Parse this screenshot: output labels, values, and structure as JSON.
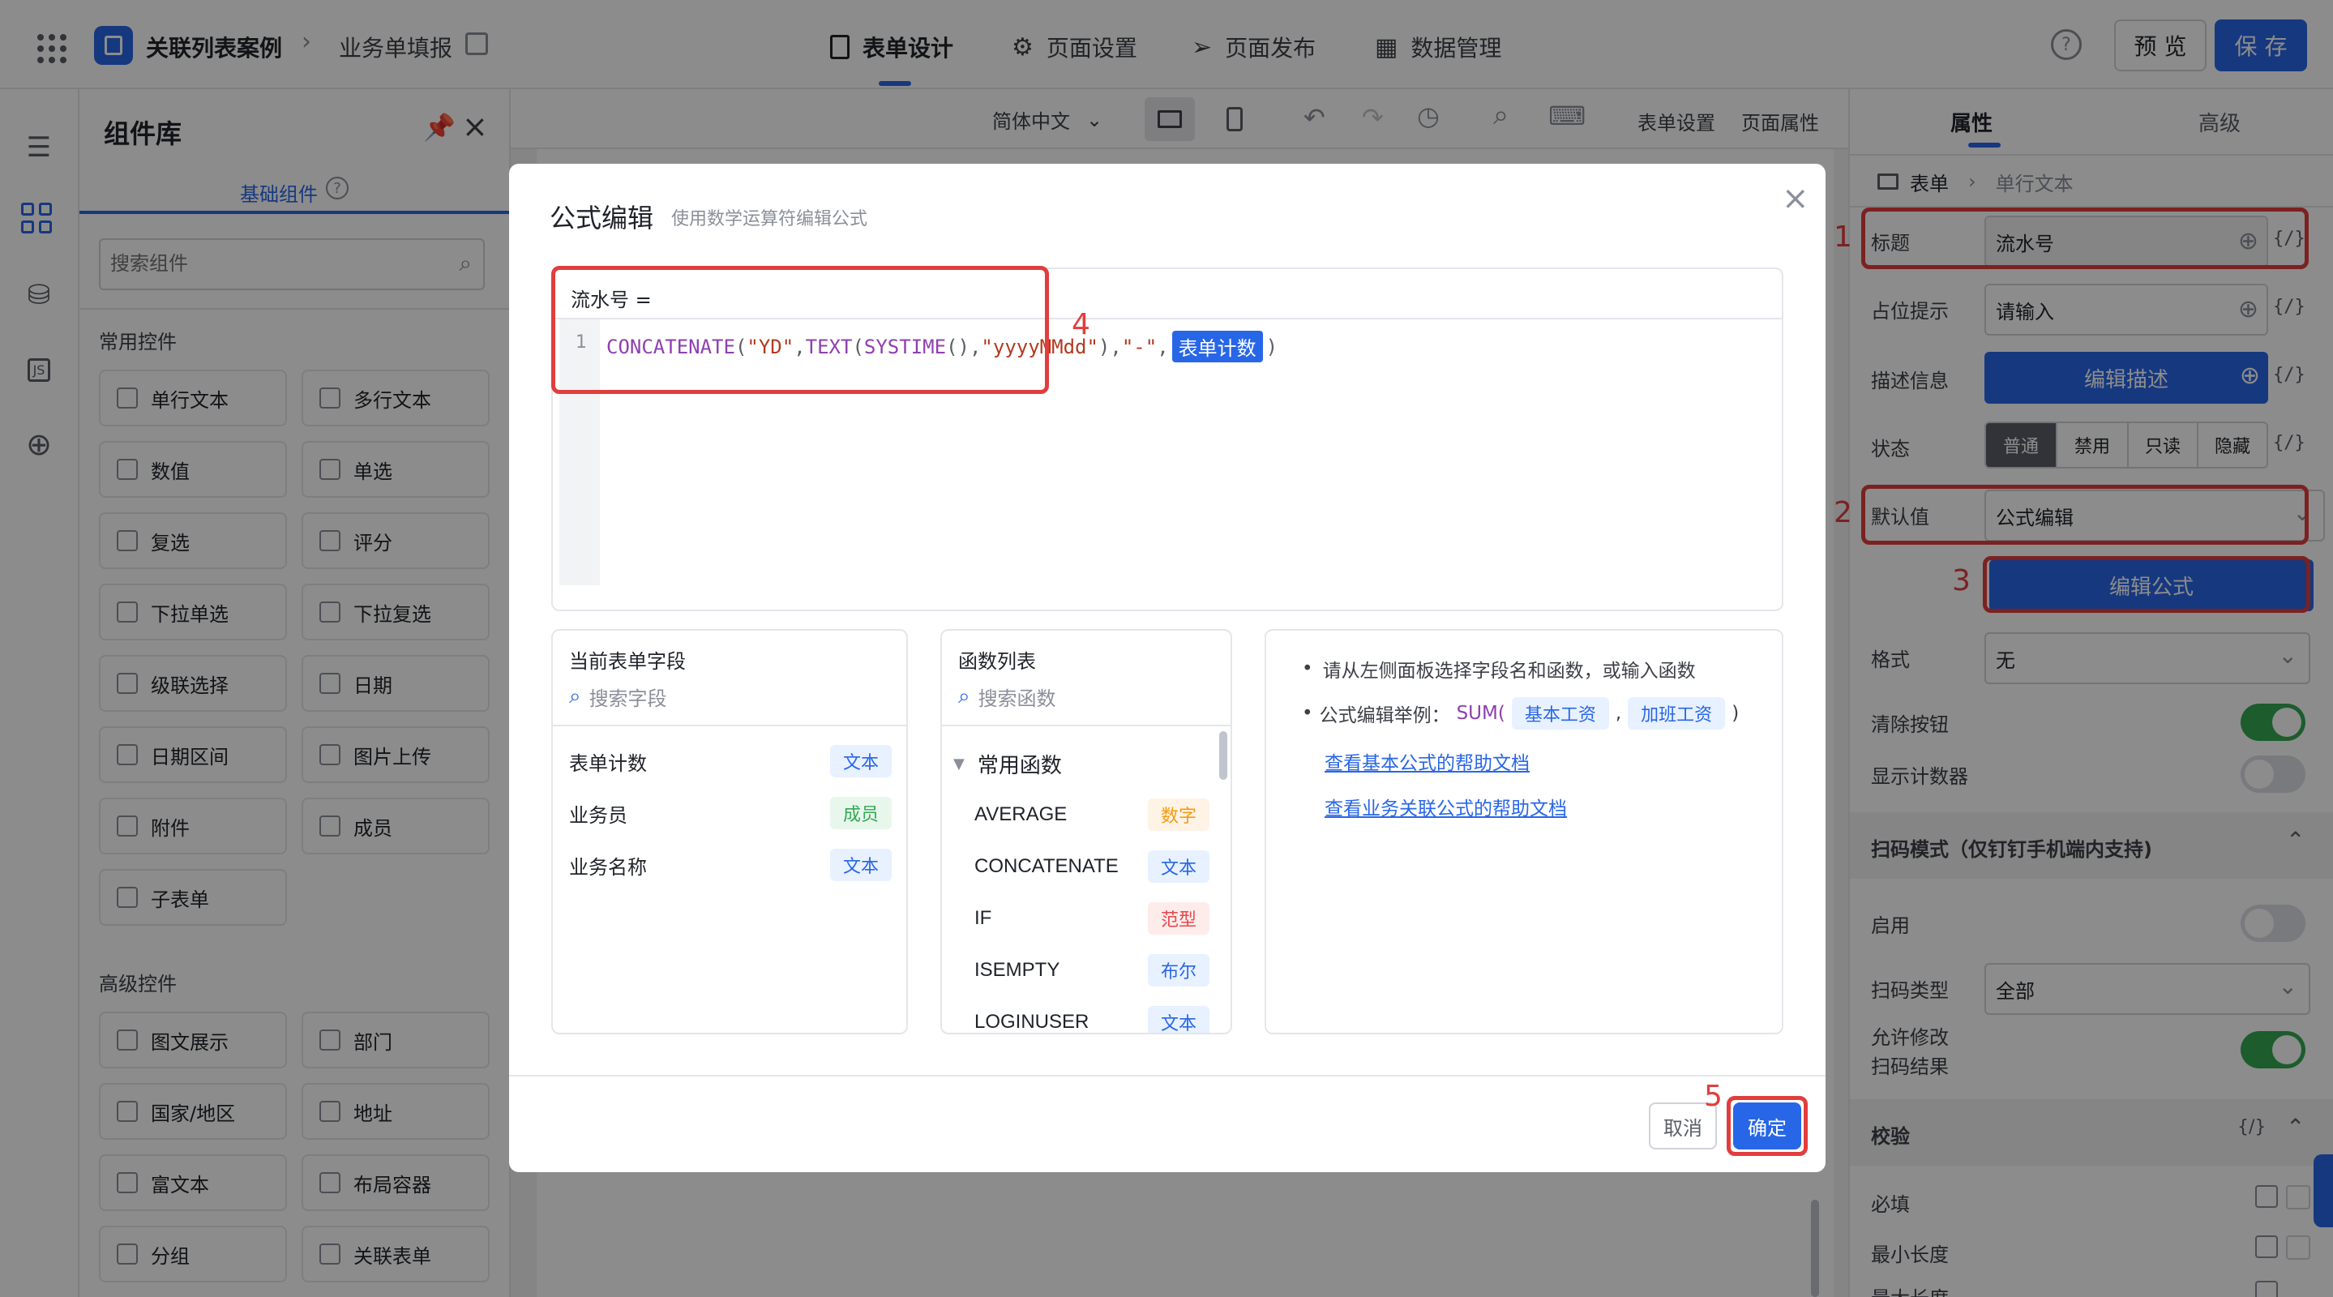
{
  "header": {
    "app_title": "关联列表案例",
    "page_name": "业务单填报",
    "tabs": [
      "表单设计",
      "页面设置",
      "页面发布",
      "数据管理"
    ],
    "help": "?",
    "preview_label": "预 览",
    "save_label": "保 存"
  },
  "left_rail": {
    "icons": [
      "outline-icon",
      "components-icon",
      "database-icon",
      "js-icon",
      "globe-icon"
    ],
    "js_label": "JS"
  },
  "library": {
    "title": "组件库",
    "tab": "基础组件",
    "search_placeholder": "搜索组件",
    "common_title": "常用控件",
    "common": [
      "单行文本",
      "多行文本",
      "数值",
      "单选",
      "复选",
      "评分",
      "下拉单选",
      "下拉复选",
      "级联选择",
      "日期",
      "日期区间",
      "图片上传",
      "附件",
      "成员",
      "子表单"
    ],
    "advanced_title": "高级控件",
    "advanced": [
      "图文展示",
      "部门",
      "国家/地区",
      "地址",
      "富文本",
      "布局容器",
      "分组",
      "关联表单"
    ]
  },
  "canvas_toolbar": {
    "language": "简体中文",
    "form_settings": "表单设置",
    "page_props": "页面属性"
  },
  "right_panel": {
    "tabs": [
      "属性",
      "高级"
    ],
    "breadcrumb": [
      "表单",
      "单行文本"
    ],
    "fx": "{/}",
    "rows": {
      "title_label": "标题",
      "title_value": "流水号",
      "placeholder_label": "占位提示",
      "placeholder_value": "请输入",
      "desc_label": "描述信息",
      "desc_button": "编辑描述",
      "state_label": "状态",
      "state_options": [
        "普通",
        "禁用",
        "只读",
        "隐藏"
      ],
      "default_label": "默认值",
      "default_value": "公式编辑",
      "edit_formula": "编辑公式",
      "format_label": "格式",
      "format_value": "无",
      "clear_label": "清除按钮",
      "counter_label": "显示计数器",
      "scan_section": "扫码模式（仅钉钉手机端内支持)",
      "enable_label": "启用",
      "scan_type_label": "扫码类型",
      "scan_type_value": "全部",
      "allow_edit_label_1": "允许修改",
      "allow_edit_label_2": "扫码结果",
      "validate_section": "校验",
      "required_label": "必填",
      "min_length_label": "最小长度",
      "max_length_label": "最大长度"
    }
  },
  "modal": {
    "title": "公式编辑",
    "subtitle": "使用数学运算符编辑公式",
    "formula_target": "流水号 =",
    "line_number": "1",
    "formula_func1": "CONCATENATE",
    "formula_open": "(",
    "formula_str1": "\"YD\"",
    "formula_comma": ",",
    "formula_func2": "TEXT",
    "formula_func3": "SYSTIME",
    "formula_parens": "()",
    "formula_str2": "\"yyyyMMdd\"",
    "formula_close": ")",
    "formula_str3": "\"-\"",
    "formula_field": "表单计数",
    "fields_title": "当前表单字段",
    "fields_search": "搜索字段",
    "fields": [
      {
        "name": "表单计数",
        "type": "文本"
      },
      {
        "name": "业务员",
        "type": "成员"
      },
      {
        "name": "业务名称",
        "type": "文本"
      }
    ],
    "functions_title": "函数列表",
    "functions_search": "搜索函数",
    "functions_group": "常用函数",
    "functions": [
      {
        "name": "AVERAGE",
        "type": "数字"
      },
      {
        "name": "CONCATENATE",
        "type": "文本"
      },
      {
        "name": "IF",
        "type": "范型"
      },
      {
        "name": "ISEMPTY",
        "type": "布尔"
      },
      {
        "name": "LOGINUSER",
        "type": "文本"
      }
    ],
    "tip1": "请从左侧面板选择字段名和函数，或输入函数",
    "tip2_prefix": "公式编辑举例：",
    "tip2_func": "SUM(",
    "tip2_field1": "基本工资",
    "tip2_comma": ",",
    "tip2_field2": "加班工资",
    "tip2_close": ")",
    "link1": "查看基本公式的帮助文档",
    "link2": "查看业务关联公式的帮助文档",
    "cancel": "取消",
    "confirm": "确定"
  },
  "annotations": [
    "1",
    "2",
    "3",
    "4",
    "5"
  ],
  "colors": {
    "primary": "#2866e8",
    "annotation": "#e23d3d",
    "toggle_on": "#34a853"
  }
}
